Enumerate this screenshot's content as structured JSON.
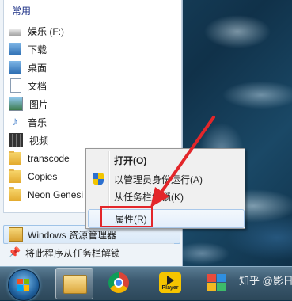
{
  "start_menu": {
    "section_title": "常用",
    "items": [
      {
        "label": "娱乐 (F:)",
        "icon": "drive-icon"
      },
      {
        "label": "下载",
        "icon": "download-folder-icon"
      },
      {
        "label": "桌面",
        "icon": "desktop-folder-icon"
      },
      {
        "label": "文档",
        "icon": "documents-icon"
      },
      {
        "label": "图片",
        "icon": "pictures-icon"
      },
      {
        "label": "音乐",
        "icon": "music-icon"
      },
      {
        "label": "视频",
        "icon": "video-icon"
      },
      {
        "label": "transcode",
        "icon": "folder-icon"
      },
      {
        "label": "Copies",
        "icon": "folder-icon"
      },
      {
        "label": "Neon Genesi",
        "icon": "folder-icon"
      }
    ],
    "pinned_app": "Windows 资源管理器",
    "unpin_label": "将此程序从任务栏解锁"
  },
  "context_menu": {
    "items": [
      {
        "label": "打开(O)",
        "bold": true
      },
      {
        "label": "以管理员身份运行(A)",
        "icon": "uac-shield-icon"
      },
      {
        "label": "从任务栏解锁(K)"
      },
      {
        "label": "属性(R)",
        "selected": true
      }
    ]
  },
  "taskbar": {
    "apps": [
      "windows-explorer-icon",
      "chrome-icon",
      "potplayer-icon",
      "app-icon"
    ],
    "player_text": "Player"
  },
  "watermark": {
    "text": "知乎 @影日常"
  },
  "colors": {
    "annotation_red": "#e3262a",
    "taskbar": "#3c5a70",
    "menu_bg": "#f0f0f0"
  }
}
